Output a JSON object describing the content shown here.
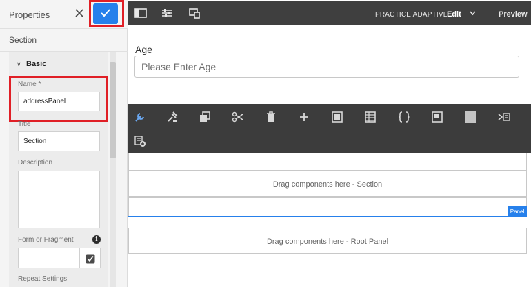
{
  "properties_panel": {
    "title": "Properties",
    "section_label": "Section",
    "group_label": "Basic",
    "name_label": "Name *",
    "name_value": "addressPanel",
    "title_label": "Title",
    "title_value": "Section",
    "description_label": "Description",
    "fragment_label": "Form or Fragment",
    "repeat_label": "Repeat Settings"
  },
  "topbar": {
    "page_title": "PRACTICE ADAPTIVE FO",
    "mode_label": "Edit",
    "preview_label": "Preview"
  },
  "form": {
    "age_label": "Age",
    "age_placeholder": "Please Enter Age"
  },
  "drop_zones": {
    "section": "Drag components here - Section",
    "root_panel": "Drag components here - Root Panel"
  },
  "panel_badge": "Panel",
  "colors": {
    "accent": "#2680eb",
    "highlight": "#e01f26",
    "toolbar": "#3c3c3c"
  }
}
